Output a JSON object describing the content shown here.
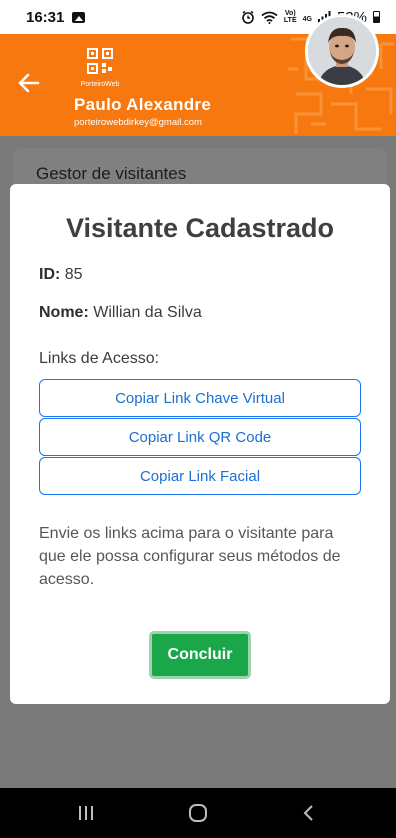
{
  "status_bar": {
    "time": "16:31",
    "lte_top": "Vo)",
    "lte_bottom": "LTE",
    "network": "4G",
    "battery": "53%"
  },
  "header": {
    "logo_text": "PorteiroWeb",
    "user_name": "Paulo Alexandre",
    "user_email": "porteirowebdirkey@gmail.com"
  },
  "background_page": {
    "card_title": "Gestor de visitantes"
  },
  "modal": {
    "title": "Visitante Cadastrado",
    "id_label": "ID:",
    "id_value": "85",
    "name_label": "Nome:",
    "name_value": "Willian da Silva",
    "links_label": "Links de Acesso:",
    "link_buttons": [
      "Copiar Link Chave Virtual",
      "Copiar Link QR Code",
      "Copiar Link Facial"
    ],
    "info_text": "Envie os links acima para o visitante para que ele possa configurar seus métodos de acesso.",
    "done_label": "Concluir"
  },
  "colors": {
    "header_orange": "#f7780f",
    "success_green": "#1aa74a",
    "link_blue": "#1a75f0"
  },
  "icons": [
    "gallery-icon",
    "alarm-icon",
    "wifi-icon",
    "signal-icon",
    "battery-icon",
    "back-arrow-icon",
    "qr-logo-icon",
    "recent-apps-icon",
    "home-icon",
    "back-icon"
  ]
}
